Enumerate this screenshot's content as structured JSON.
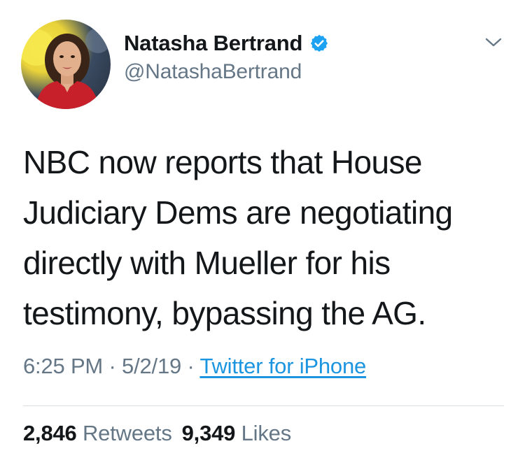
{
  "user": {
    "display_name": "Natasha Bertrand",
    "handle": "@NatashaBertrand",
    "verified": true,
    "avatar_icon": "profile-photo"
  },
  "tweet": {
    "text": "NBC now reports that House\nJudiciary Dems are negotiating\ndirectly with Mueller for his\ntestimony, bypassing the AG."
  },
  "meta": {
    "time": "6:25 PM",
    "separator": "·",
    "date": "5/2/19",
    "source": "Twitter for iPhone"
  },
  "stats": {
    "retweets_count": "2,846",
    "retweets_label": "Retweets",
    "likes_count": "9,349",
    "likes_label": "Likes"
  },
  "colors": {
    "text": "#14171a",
    "secondary": "#657786",
    "link": "#1b95e0",
    "verified": "#1da1f2"
  },
  "icons": {
    "verified": "verified-badge-icon",
    "menu": "chevron-down-icon"
  }
}
